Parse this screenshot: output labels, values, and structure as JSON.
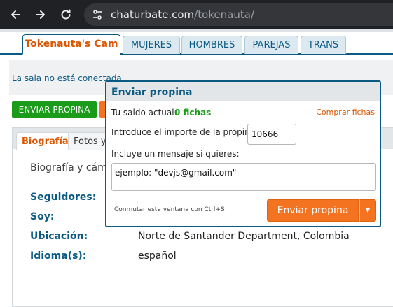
{
  "browser": {
    "url_host": "chaturbate.com",
    "url_path": "/tokenauta/",
    "icons": [
      "back-arrow-icon",
      "forward-arrow-icon",
      "reload-icon",
      "site-info-icon"
    ]
  },
  "site_tabs": [
    {
      "label": "Tokenauta's Cam",
      "active": true
    },
    {
      "label": "MUJERES"
    },
    {
      "label": "HOMBRES"
    },
    {
      "label": "PAREJAS"
    },
    {
      "label": "TRANS"
    }
  ],
  "room": {
    "status": "La sala no está conectada",
    "tip_button": "ENVIAR PROPINA"
  },
  "bio": {
    "tabs": [
      {
        "label": "Biografía",
        "active": true
      },
      {
        "label": "Fotos y"
      }
    ],
    "heading": "Biografía y cáma",
    "rows": [
      {
        "label": "Seguidores:",
        "value": ""
      },
      {
        "label": "Soy:",
        "value": ""
      },
      {
        "label": "Ubicación:",
        "value": "Norte de Santander Department, Colombia"
      },
      {
        "label": "Idioma(s):",
        "value": "español"
      }
    ]
  },
  "tip_modal": {
    "title": "Enviar propina",
    "balance_label": "Tu saldo actual:",
    "balance_value": "0 fichas",
    "buy_link": "Comprar fichas",
    "amount_label": "Introduce el importe de la propina:",
    "amount_value": "10666",
    "message_label": "Incluye un mensaje si quieres:",
    "message_value": "ejemplo: \"devjs@gmail.com\"",
    "hotkey_hint": "Conmutar esta ventana con Ctrl+S",
    "send_button": "Enviar propina",
    "send_dropdown_icon": "caret-down-icon"
  },
  "colors": {
    "brand_blue": "#0a5a83",
    "brand_orange": "#dc5500",
    "button_orange": "#f47321",
    "tip_green": "#1a9b1a"
  }
}
